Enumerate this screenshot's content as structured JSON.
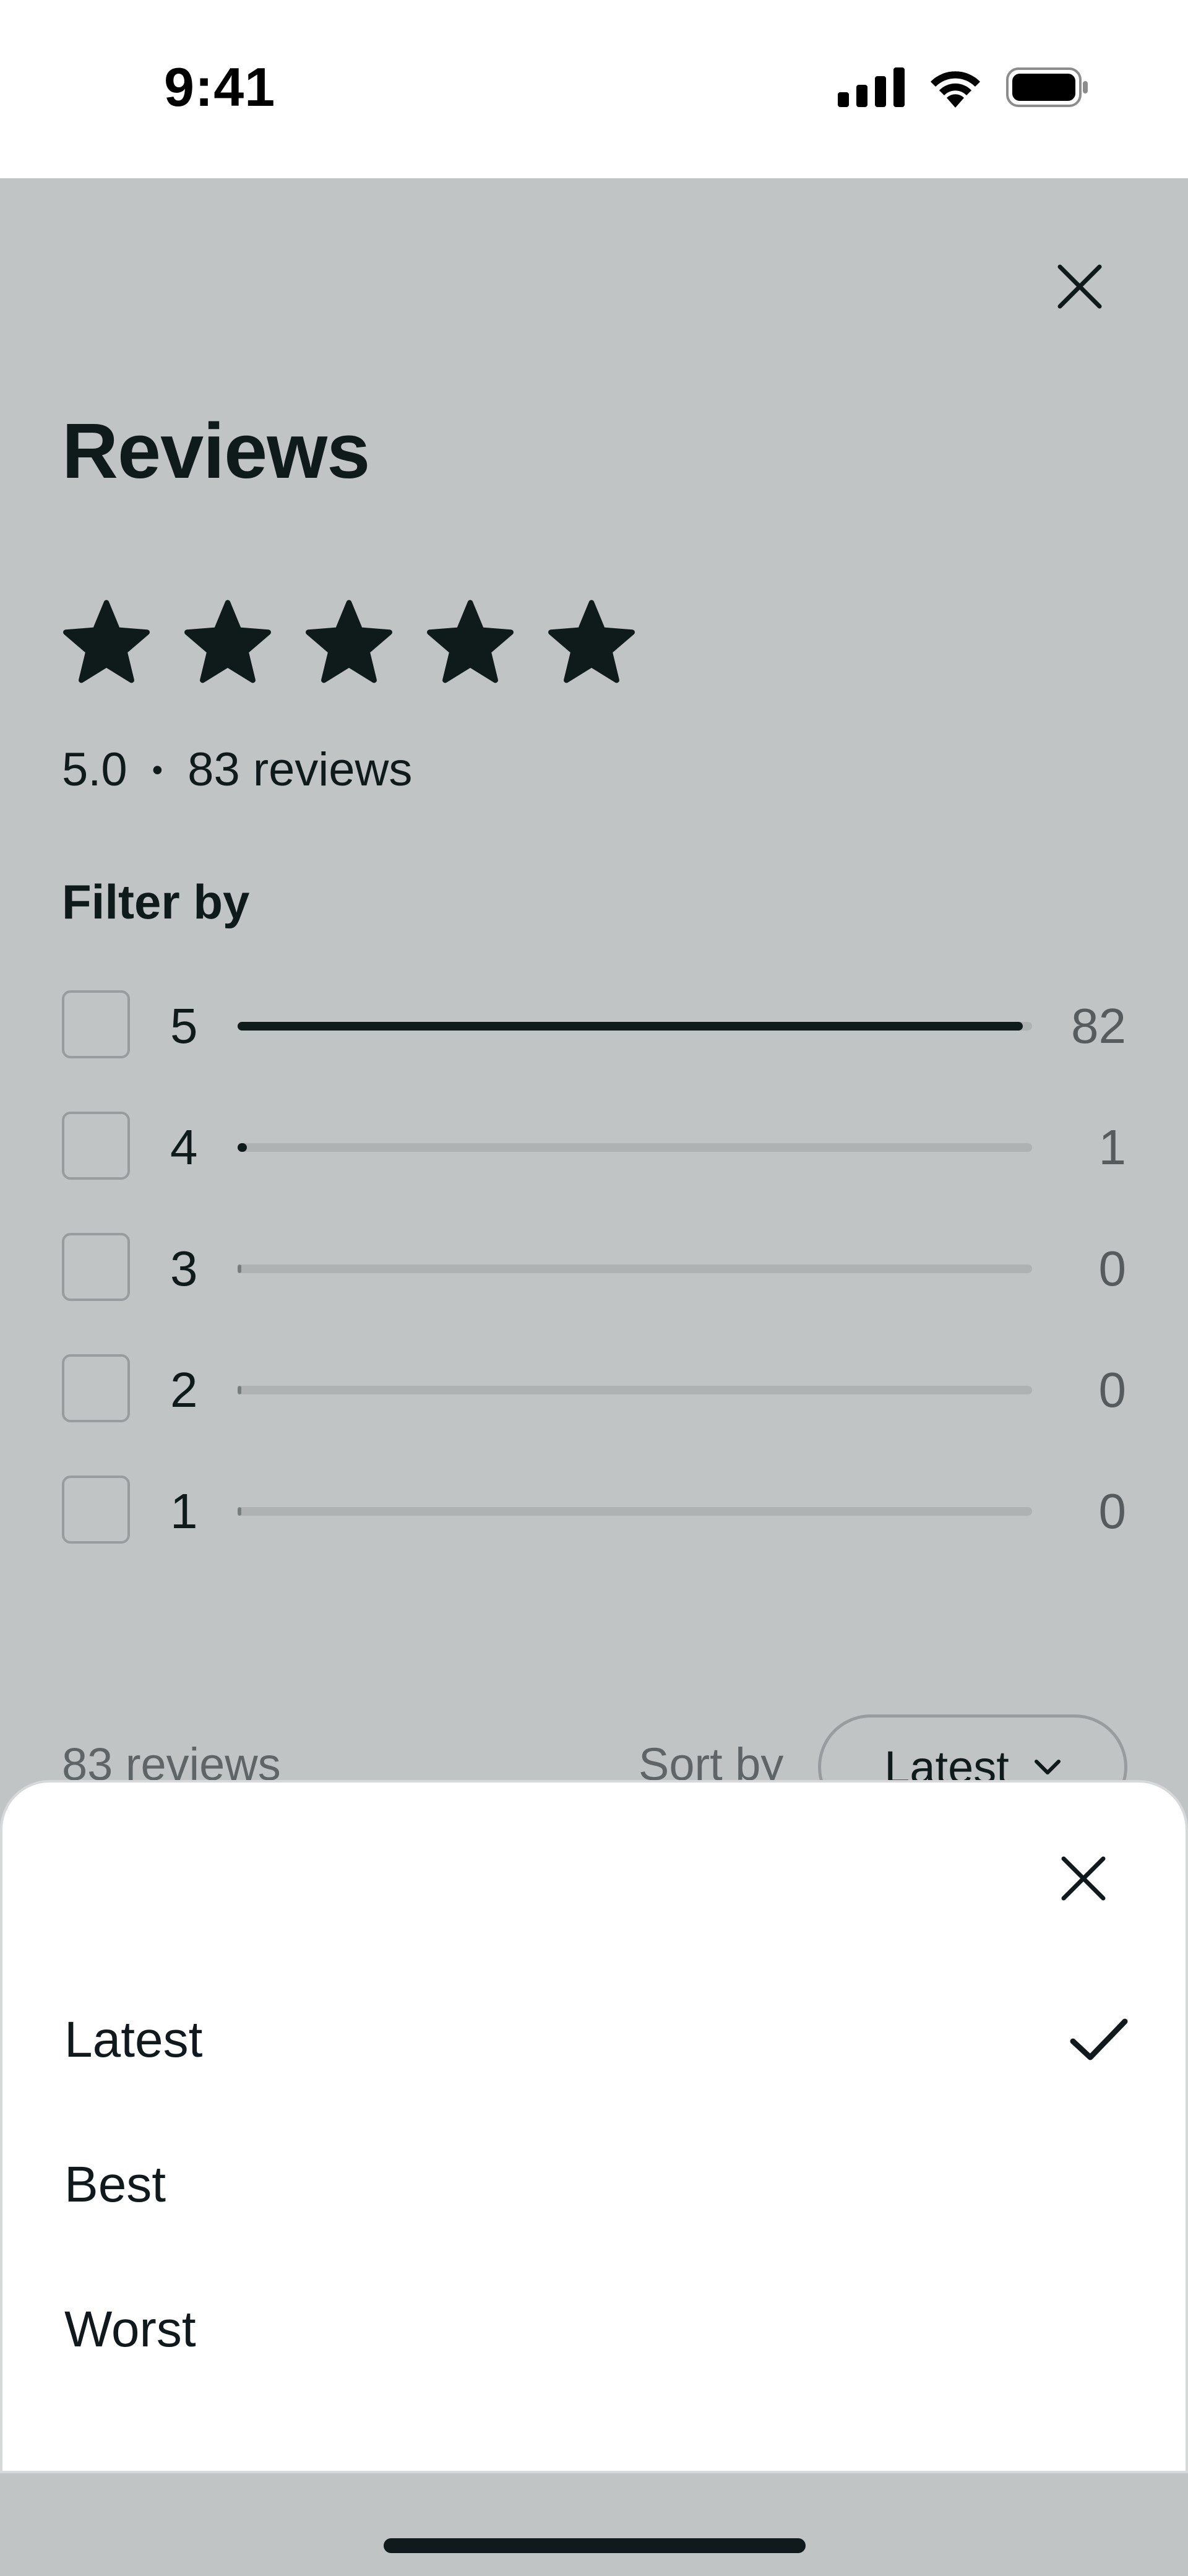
{
  "status_bar": {
    "time": "9:41",
    "icons": [
      "cellular-signal-icon",
      "wifi-icon",
      "battery-icon"
    ]
  },
  "reviews_screen": {
    "title": "Reviews",
    "star_rating": 5,
    "star_icon": "star-icon",
    "rating_value": "5.0",
    "separator": "•",
    "reviews_label": "83 reviews",
    "filter_title": "Filter by",
    "filters": [
      {
        "label": "5",
        "count": "82",
        "fraction": 0.988
      },
      {
        "label": "4",
        "count": "1",
        "fraction": 0.012
      },
      {
        "label": "3",
        "count": "0",
        "fraction": 0
      },
      {
        "label": "2",
        "count": "0",
        "fraction": 0
      },
      {
        "label": "1",
        "count": "0",
        "fraction": 0
      }
    ],
    "list_count": "83 reviews",
    "sort_label": "Sort by",
    "sort_value": "Latest",
    "close_icon": "close-icon"
  },
  "sort_sheet": {
    "close_icon": "close-icon",
    "options": [
      {
        "label": "Latest",
        "selected": true
      },
      {
        "label": "Best",
        "selected": false
      },
      {
        "label": "Worst",
        "selected": false
      }
    ],
    "selected_icon": "checkmark-icon"
  },
  "colors": {
    "text": "#101a1c",
    "muted_text": "#6f7375",
    "bar_track": "#e6e7e9",
    "bar_fill": "#101a1c",
    "scrim": "rgba(16,26,28,0.26)"
  }
}
